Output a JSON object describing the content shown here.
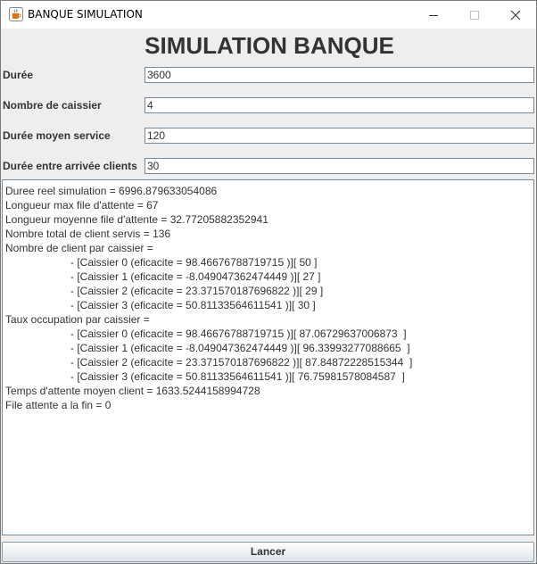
{
  "window": {
    "title": "BANQUE SIMULATION",
    "icon": "java-cup-icon"
  },
  "header": {
    "title": "SIMULATION BANQUE"
  },
  "form": {
    "duree": {
      "label": "Durée",
      "value": "3600"
    },
    "caissiers": {
      "label": "Nombre de caissier",
      "value": "4"
    },
    "service": {
      "label": "Durée moyen service",
      "value": "120"
    },
    "arrivee": {
      "label": "Durée entre arrivée clients",
      "value": "30"
    }
  },
  "output": {
    "lines": [
      "Duree reel simulation = 6996.879633054086",
      "Longueur max file d'attente = 67",
      "Longueur moyenne file d'attente = 32.77205882352941",
      "Nombre total de client servis = 136",
      "Nombre de client par caissier =",
      "- [Caissier 0 (eficacite = 98.46676788719715 )][ 50 ]",
      "- [Caissier 1 (eficacite = -8.049047362474449 )][ 27 ]",
      "- [Caissier 2 (eficacite = 23.371570187696822 )][ 29 ]",
      "- [Caissier 3 (eficacite = 50.81133564611541 )][ 30 ]",
      "Taux occupation par caissier =",
      "- [Caissier 0 (eficacite = 98.46676788719715 )][ 87.06729637006873  ]",
      "- [Caissier 1 (eficacite = -8.049047362474449 )][ 96.33993277088665  ]",
      "- [Caissier 2 (eficacite = 23.371570187696822 )][ 87.84872228515344  ]",
      "- [Caissier 3 (eficacite = 50.81133564611541 )][ 76.75981578084587  ]",
      "Temps d'attente moyen client = 1633.5244158994728",
      "File attente a la fin = 0"
    ]
  },
  "actions": {
    "launch_label": "Lancer"
  }
}
